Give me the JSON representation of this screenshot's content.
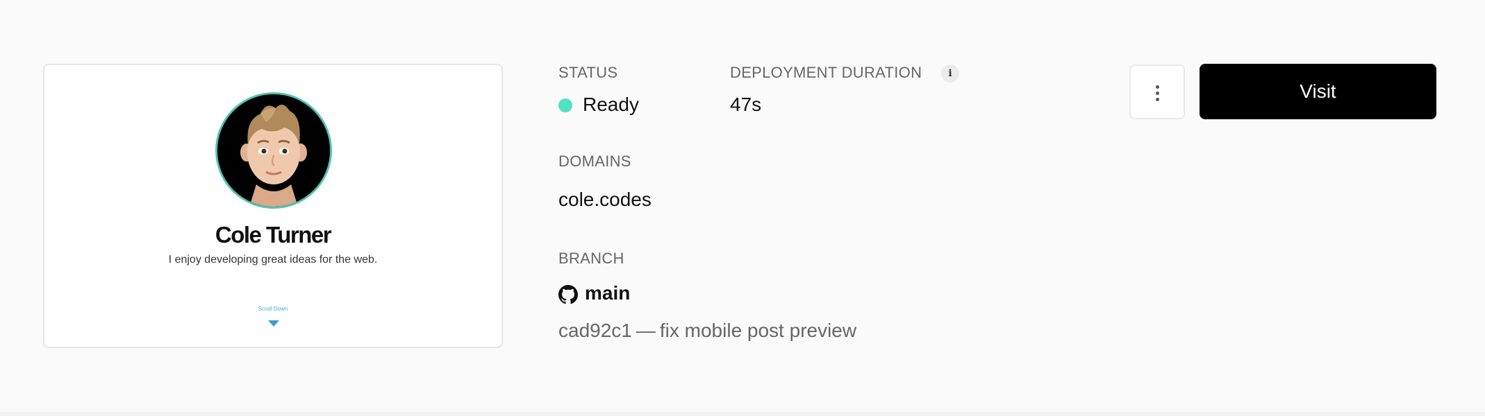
{
  "preview": {
    "name": "Cole Turner",
    "tagline": "I enjoy developing great ideas for the web.",
    "scroll_label": "Scroll Down"
  },
  "status": {
    "label": "STATUS",
    "value": "Ready",
    "color": "#50e3c2"
  },
  "duration": {
    "label": "DEPLOYMENT DURATION",
    "info_glyph": "i",
    "value": "47s"
  },
  "domains": {
    "label": "DOMAINS",
    "value": "cole.codes"
  },
  "branch": {
    "label": "BRANCH",
    "name": "main",
    "icon": "github-icon",
    "commit_hash": "cad92c1",
    "commit_separator": "—",
    "commit_message": "fix mobile post preview"
  },
  "actions": {
    "more_icon": "more-vertical-icon",
    "visit_label": "Visit"
  }
}
